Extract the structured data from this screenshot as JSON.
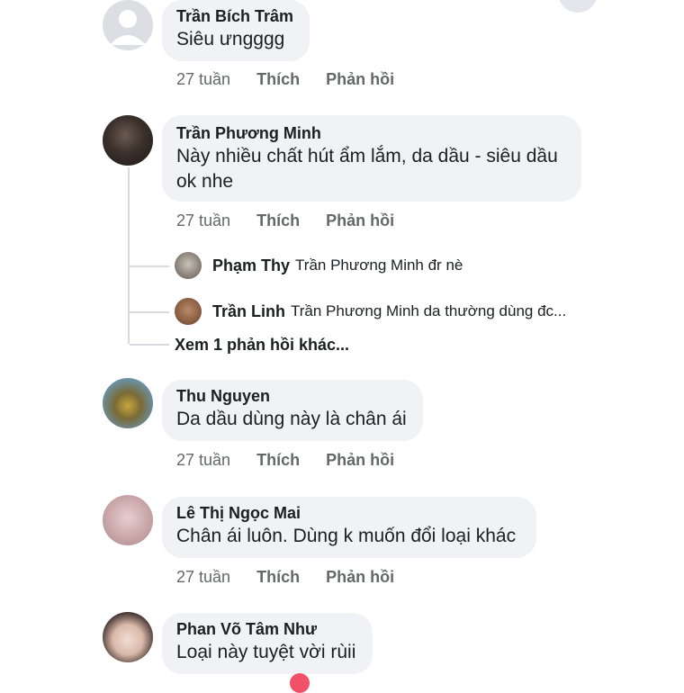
{
  "comments": [
    {
      "name": "Trần Bích Trâm",
      "text": "Siêu ưngggg",
      "time": "27 tuần",
      "like": "Thích",
      "reply": "Phản hồi",
      "avatar_icon": "default-avatar-icon"
    },
    {
      "name": "Trần Phương Minh",
      "text_line1": "Này nhiều chất hút ẩm lắm, da dầu - siêu dầu",
      "text_line2": "ok nhe",
      "time": "27 tuần",
      "like": "Thích",
      "reply": "Phản hồi"
    },
    {
      "name": "Thu Nguyen",
      "text": "Da dầu dùng này là chân ái",
      "time": "27 tuần",
      "like": "Thích",
      "reply": "Phản hồi"
    },
    {
      "name": "Lê Thị Ngọc Mai",
      "text": "Chân ái luôn. Dùng k muốn đổi loại khác",
      "time": "27 tuần",
      "like": "Thích",
      "reply": "Phản hồi"
    },
    {
      "name": "Phan Võ Tâm Như",
      "text": "Loại này tuyệt vời rùii"
    }
  ],
  "replies": [
    {
      "name": "Phạm Thy",
      "text": "Trần Phương Minh đr nè"
    },
    {
      "name": "Trần Linh",
      "text": "Trần Phương Minh da thường dùng đc..."
    }
  ],
  "more_replies": "Xem 1 phản hồi khác...",
  "colors": {
    "bubble": "#f0f2f5",
    "meta": "#65676b",
    "text": "#1c1e21"
  }
}
